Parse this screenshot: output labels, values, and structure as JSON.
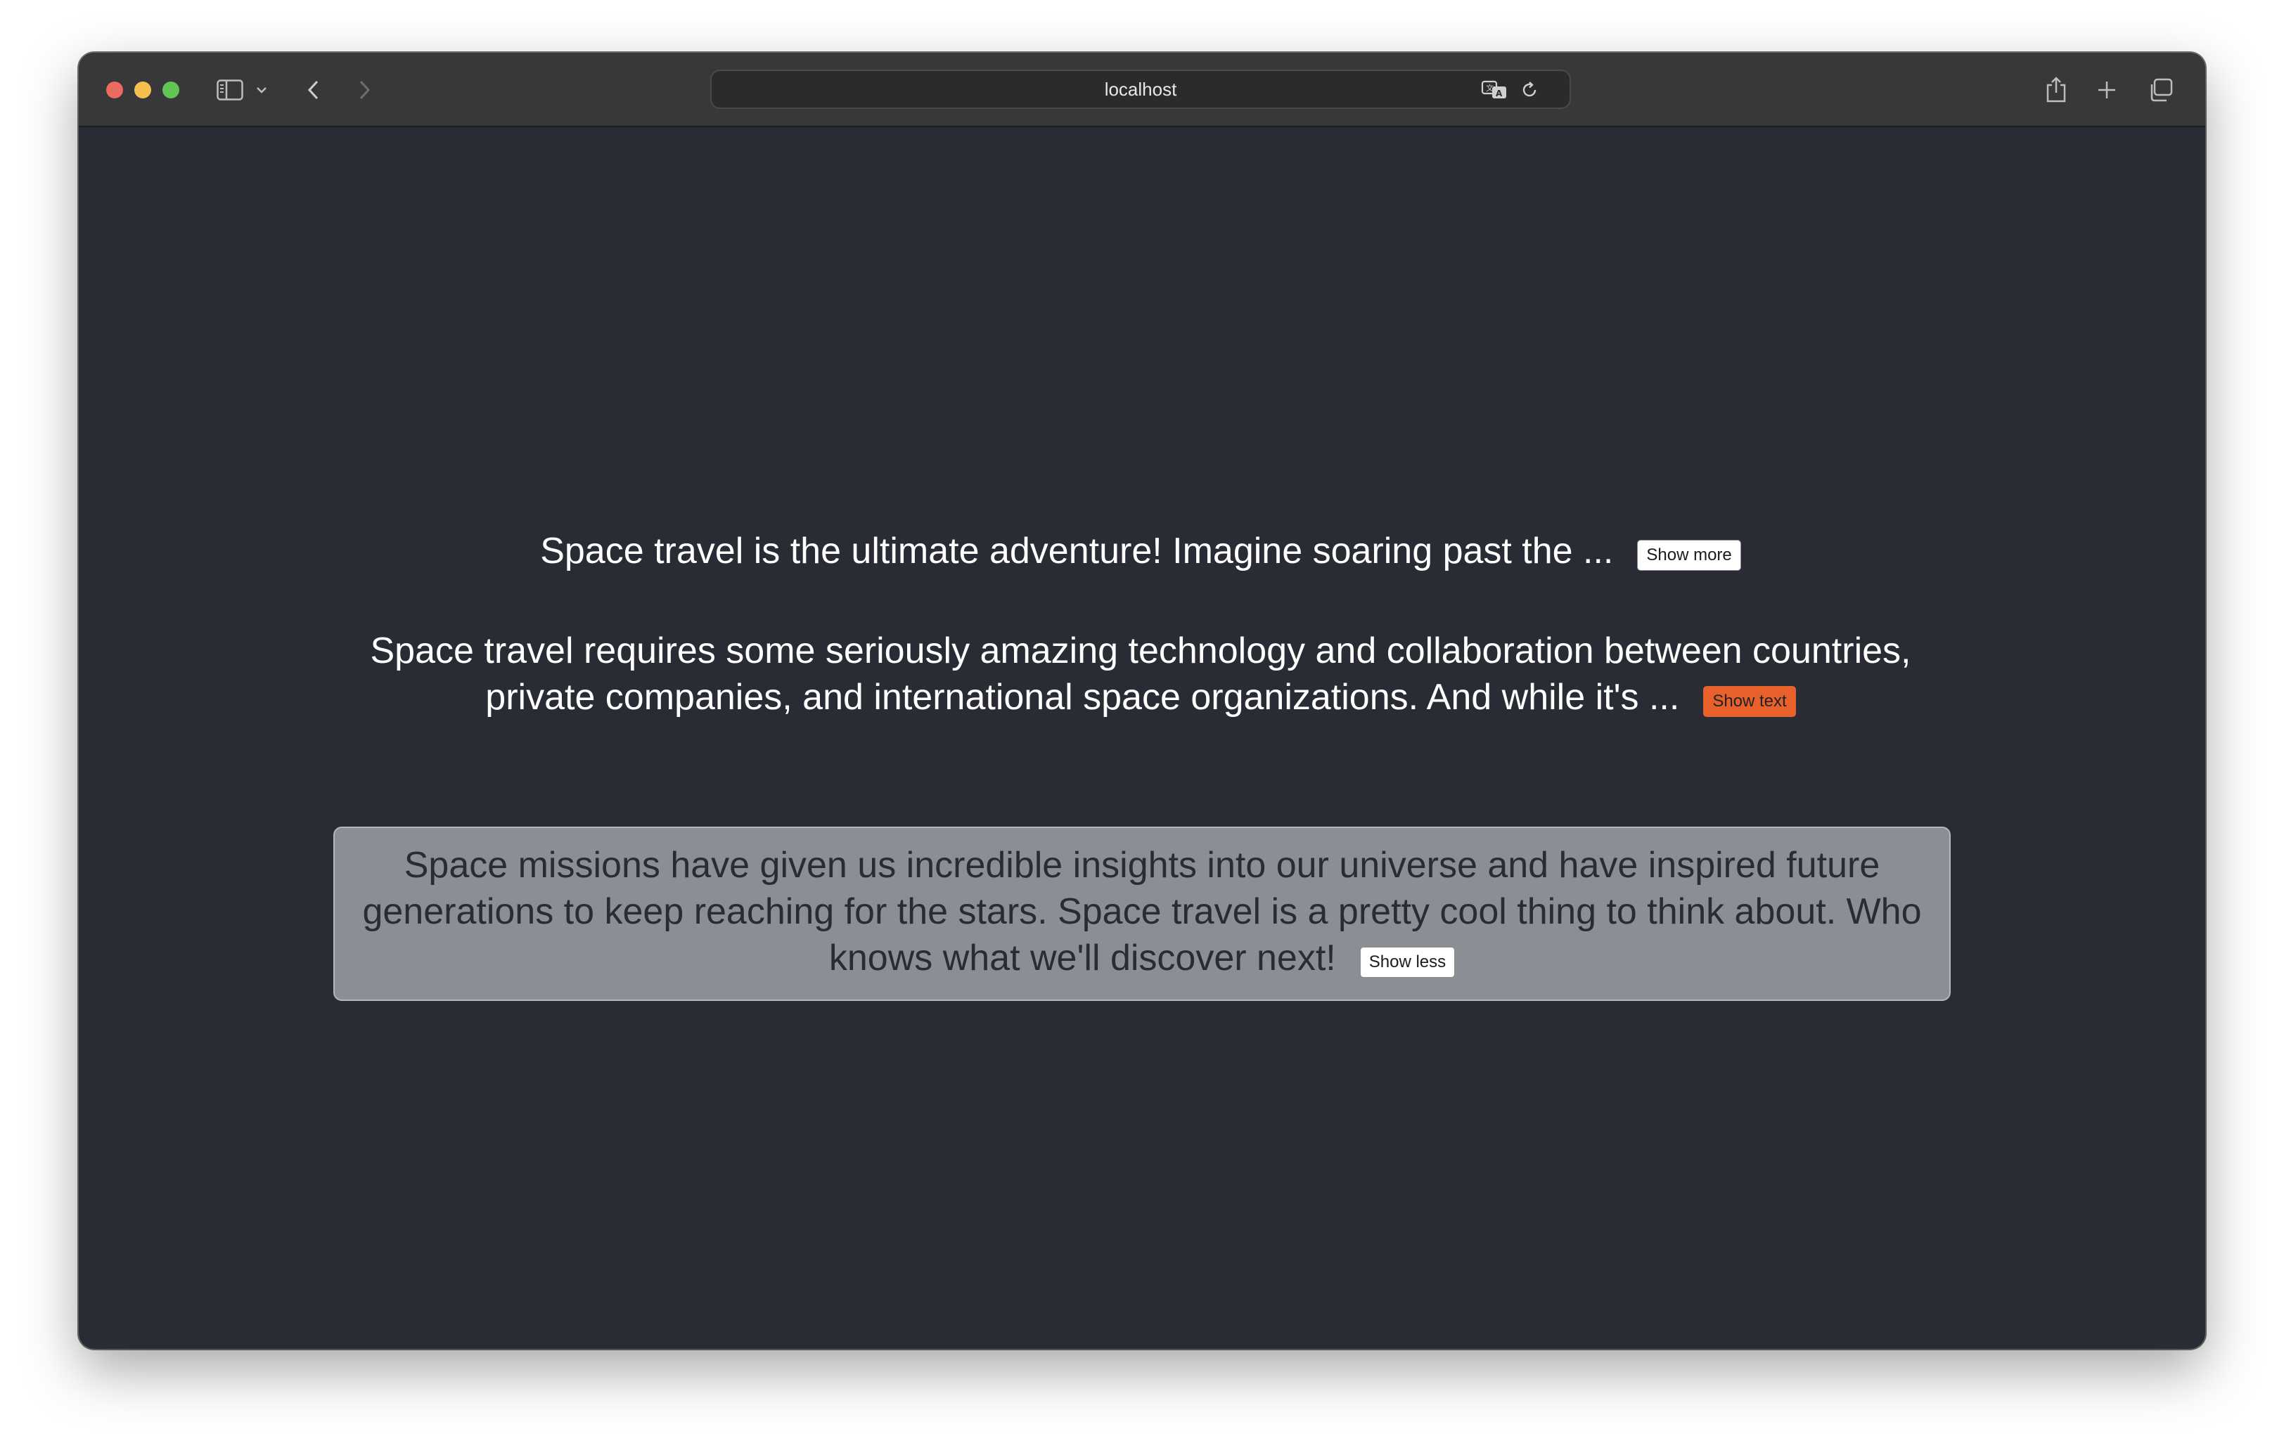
{
  "browser": {
    "address": "localhost",
    "icons": {
      "sidebar": "sidebar-icon",
      "chevron": "chevron-down-icon",
      "back": "back-arrow-icon",
      "forward": "forward-arrow-icon",
      "translate": "translate-icon",
      "reload": "reload-icon",
      "share": "share-icon",
      "new_tab": "plus-icon",
      "tabs": "tab-overview-icon"
    }
  },
  "paragraphs": [
    {
      "text": "Space travel is the ultimate adventure! Imagine soaring past the ...",
      "button": "Show more"
    },
    {
      "text": "Space travel requires some seriously amazing technology and collaboration between countries, private companies, and international space organizations. And while it's ...",
      "button": "Show text"
    },
    {
      "text": "Space missions have given us incredible insights into our universe and have inspired future generations to keep reaching for the stars. Space travel is a pretty cool thing to think about. Who knows what we'll discover next!",
      "button": "Show less"
    }
  ],
  "colors": {
    "page_bg": "#292c34",
    "accent_button": "#e8602c",
    "expanded_box_bg": "#8a8e95"
  }
}
